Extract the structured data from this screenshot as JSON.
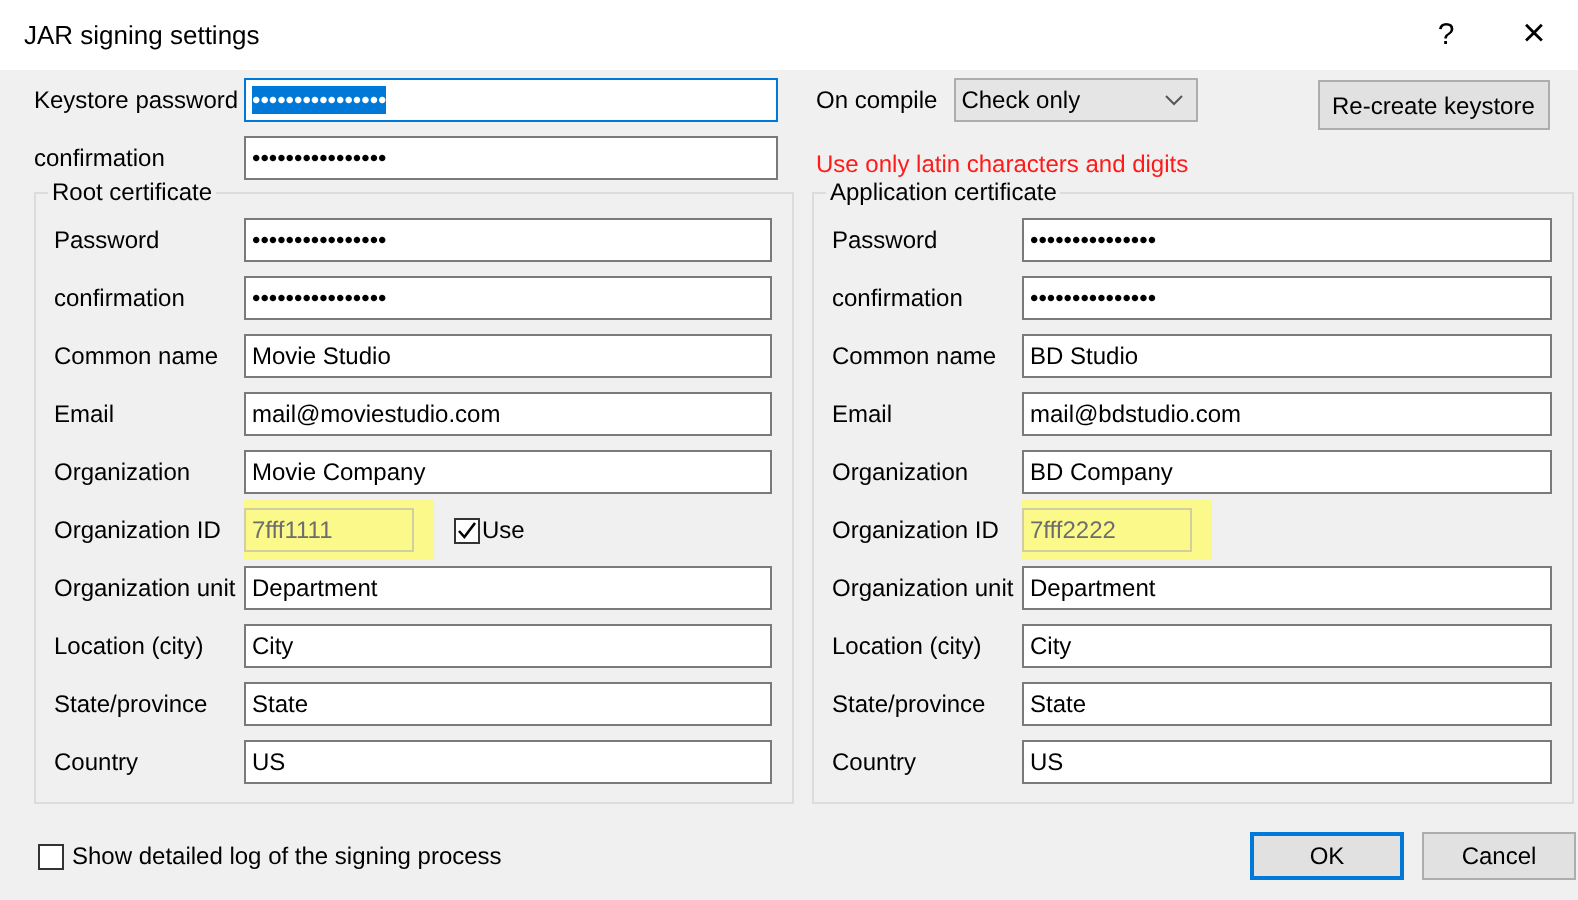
{
  "window": {
    "title": "JAR signing settings",
    "help": "?",
    "close": "×"
  },
  "keystore": {
    "fields": [
      {
        "label": "Keystore password",
        "value": "••••••••••••••••",
        "focused": true
      },
      {
        "label": "confirmation",
        "value": "••••••••••••••••",
        "focused": false
      }
    ]
  },
  "on_compile": {
    "label": "On compile",
    "value": "Check only"
  },
  "recreate_button": "Re-create keystore",
  "warning": "Use only latin characters and digits",
  "groups": [
    {
      "title": "Root certificate",
      "fields": [
        {
          "label": "Password",
          "value": "••••••••••••••••",
          "disabled": false,
          "highlighted": false
        },
        {
          "label": "confirmation",
          "value": "••••••••••••••••",
          "disabled": false,
          "highlighted": false
        },
        {
          "label": "Common name",
          "value": "Movie Studio",
          "disabled": false,
          "highlighted": false
        },
        {
          "label": "Email",
          "value": "mail@moviestudio.com",
          "disabled": false,
          "highlighted": false
        },
        {
          "label": "Organization",
          "value": "Movie Company",
          "disabled": false,
          "highlighted": false
        },
        {
          "label": "Organization ID",
          "value": "7fff1111",
          "disabled": true,
          "highlighted": true,
          "checkbox": {
            "label": "Use",
            "checked": true
          }
        },
        {
          "label": "Organization unit",
          "value": "Department",
          "disabled": false,
          "highlighted": false
        },
        {
          "label": "Location (city)",
          "value": "City",
          "disabled": false,
          "highlighted": false
        },
        {
          "label": "State/province",
          "value": "State",
          "disabled": false,
          "highlighted": false
        },
        {
          "label": "Country",
          "value": "US",
          "disabled": false,
          "highlighted": false
        }
      ]
    },
    {
      "title": "Application certificate",
      "fields": [
        {
          "label": "Password",
          "value": "•••••••••••••••",
          "disabled": false,
          "highlighted": false
        },
        {
          "label": "confirmation",
          "value": "•••••••••••••••",
          "disabled": false,
          "highlighted": false
        },
        {
          "label": "Common name",
          "value": "BD Studio",
          "disabled": false,
          "highlighted": false
        },
        {
          "label": "Email",
          "value": "mail@bdstudio.com",
          "disabled": false,
          "highlighted": false
        },
        {
          "label": "Organization",
          "value": "BD Company",
          "disabled": false,
          "highlighted": false
        },
        {
          "label": "Organization ID",
          "value": "7fff2222",
          "disabled": true,
          "highlighted": true
        },
        {
          "label": "Organization unit",
          "value": "Department",
          "disabled": false,
          "highlighted": false
        },
        {
          "label": "Location (city)",
          "value": "City",
          "disabled": false,
          "highlighted": false
        },
        {
          "label": "State/province",
          "value": "State",
          "disabled": false,
          "highlighted": false
        },
        {
          "label": "Country",
          "value": "US",
          "disabled": false,
          "highlighted": false
        }
      ]
    }
  ],
  "log_checkbox": {
    "label": "Show detailed log of the signing process",
    "checked": false
  },
  "buttons": [
    {
      "label": "OK",
      "default": true
    },
    {
      "label": "Cancel",
      "default": false
    }
  ]
}
